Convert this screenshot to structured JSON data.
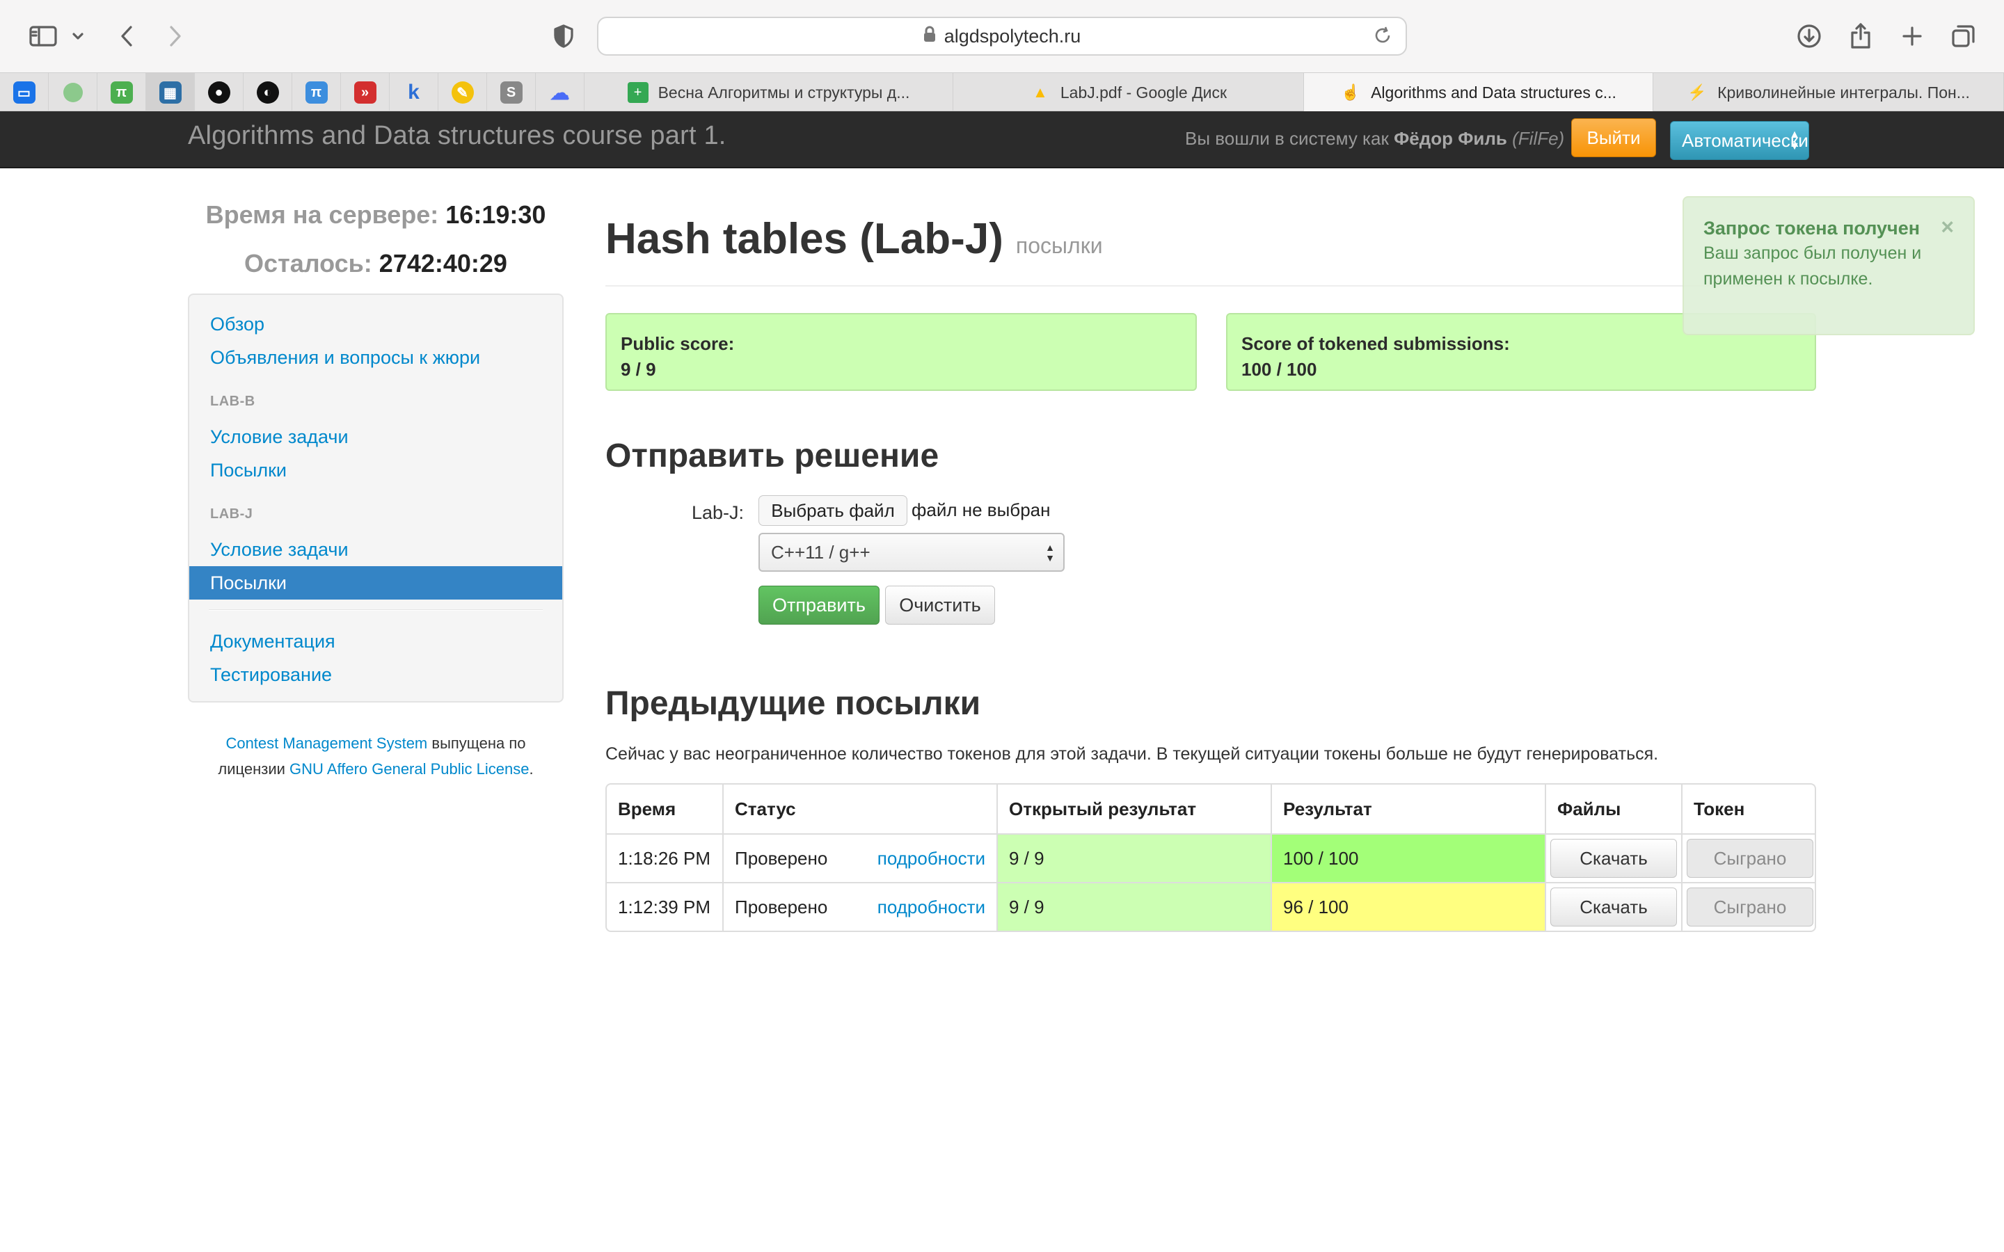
{
  "browser": {
    "url": "algdspolytech.ru",
    "tabs": [
      {
        "label": "Весна Алгоритмы и структуры д...",
        "active": false
      },
      {
        "label": "LabJ.pdf - Google Диск",
        "active": false
      },
      {
        "label": "Algorithms and Data structures c...",
        "active": true
      },
      {
        "label": "Криволинейные интегралы. Пон...",
        "active": false
      }
    ],
    "pinned_icons": [
      "chat-icon",
      "circle-icon",
      "pi-icon",
      "grid-icon",
      "github-icon",
      "swirl-icon",
      "pi-icon",
      "video-icon",
      "k-letter-icon",
      "pencil-icon",
      "s-letter-icon",
      "bird-icon"
    ]
  },
  "navbar": {
    "brand": "Algorithms and Data structures course part 1.",
    "logged_prefix": "Вы вошли в систему как",
    "user_name": "Фёдор Филь",
    "user_login": "(FilFe)",
    "logout_label": "Выйти",
    "language_label": "Автоматически"
  },
  "sidebar": {
    "server_time_label": "Время на сервере:",
    "server_time": "16:19:30",
    "remaining_label": "Осталось:",
    "remaining": "2742:40:29",
    "links": {
      "overview": "Обзор",
      "announcements": "Объявления и вопросы к жюри",
      "lab_b_header": "LAB-B",
      "lab_b_statement": "Условие задачи",
      "lab_b_submissions": "Посылки",
      "lab_j_header": "LAB-J",
      "lab_j_statement": "Условие задачи",
      "lab_j_submissions": "Посылки",
      "documentation": "Документация",
      "testing": "Тестирование"
    },
    "footer": {
      "cms_link": "Contest Management System",
      "text1": "выпущена по",
      "text2": "лицензии",
      "license_link": "GNU Affero General Public License",
      "dot": "."
    }
  },
  "main": {
    "title": "Hash tables (Lab-J)",
    "subtitle": "посылки",
    "public_score_label": "Public score:",
    "public_score": "9 / 9",
    "tokened_score_label": "Score of tokened submissions:",
    "tokened_score": "100 / 100",
    "submit_heading": "Отправить решение",
    "file_label": "Lab-J:",
    "choose_file": "Выбрать файл",
    "no_file": "файл не выбран",
    "language": "C++11 / g++",
    "submit_button": "Отправить",
    "clear_button": "Очистить",
    "previous_heading": "Предыдущие посылки",
    "tokens_note": "Сейчас у вас неограниченное количество токенов для этой задачи. В текущей ситуации токены больше не будут генерироваться.",
    "table": {
      "headers": [
        "Время",
        "Статус",
        "Открытый результат",
        "Результат",
        "Файлы",
        "Токен"
      ],
      "rows": [
        {
          "time": "1:18:26 PM",
          "status": "Проверено",
          "details": "подробности",
          "public": "9 / 9",
          "result": "100 / 100",
          "download": "Скачать",
          "token": "Сыграно"
        },
        {
          "time": "1:12:39 PM",
          "status": "Проверено",
          "details": "подробности",
          "public": "9 / 9",
          "result": "96 / 100",
          "download": "Скачать",
          "token": "Сыграно"
        }
      ]
    }
  },
  "toast": {
    "title": "Запрос токена получен",
    "message": "Ваш запрос был получен и применен к посылке.",
    "close": "×"
  },
  "colors": {
    "score_green": "#ccffb3",
    "full_score_green": "#a3ff78",
    "partial_score_yellow": "#ffff80",
    "link_blue": "#0088cc",
    "active_nav": "#3484c5"
  }
}
